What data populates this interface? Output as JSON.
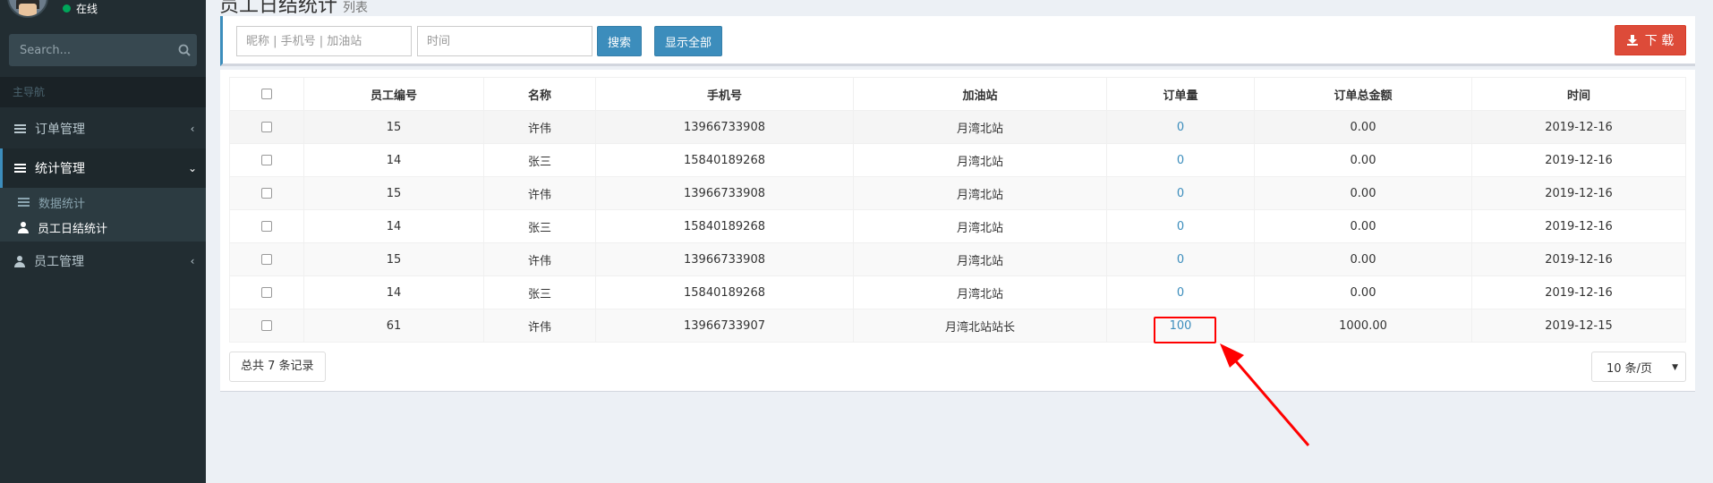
{
  "user": {
    "status": "在线"
  },
  "search": {
    "placeholder": "Search..."
  },
  "nav": {
    "header": "主导航",
    "items": [
      {
        "label": "订单管理",
        "icon": "bars-icon",
        "chevron": "‹"
      },
      {
        "label": "统计管理",
        "icon": "bars-icon",
        "chevron": "⌄"
      },
      {
        "label": "员工管理",
        "icon": "user-icon",
        "chevron": "‹"
      }
    ],
    "sub_items": [
      {
        "label": "数据统计",
        "icon": "bars-icon"
      },
      {
        "label": "员工日结统计",
        "icon": "user-icon"
      }
    ]
  },
  "page": {
    "title": "员工日结统计",
    "subtitle": "列表"
  },
  "toolbar": {
    "keyword_placeholder": "昵称 | 手机号 | 加油站",
    "time_placeholder": "时间",
    "search_label": "搜索",
    "show_all_label": "显示全部",
    "download_label": "下 载"
  },
  "table": {
    "headers": [
      "员工编号",
      "名称",
      "手机号",
      "加油站",
      "订单量",
      "订单总金额",
      "时间"
    ],
    "rows": [
      [
        "15",
        "许伟",
        "13966733908",
        "月湾北站",
        "0",
        "0.00",
        "2019-12-16"
      ],
      [
        "14",
        "张三",
        "15840189268",
        "月湾北站",
        "0",
        "0.00",
        "2019-12-16"
      ],
      [
        "15",
        "许伟",
        "13966733908",
        "月湾北站",
        "0",
        "0.00",
        "2019-12-16"
      ],
      [
        "14",
        "张三",
        "15840189268",
        "月湾北站",
        "0",
        "0.00",
        "2019-12-16"
      ],
      [
        "15",
        "许伟",
        "13966733908",
        "月湾北站",
        "0",
        "0.00",
        "2019-12-16"
      ],
      [
        "14",
        "张三",
        "15840189268",
        "月湾北站",
        "0",
        "0.00",
        "2019-12-16"
      ],
      [
        "61",
        "许伟",
        "13966733907",
        "月湾北站站长",
        "100",
        "1000.00",
        "2019-12-15"
      ]
    ]
  },
  "footer": {
    "total": "总共 7 条记录",
    "page_size": "10 条/页"
  },
  "colors": {
    "sidebar": "#222d32",
    "accent": "#3c8dbc",
    "danger": "#dd4b39",
    "annotation": "#ff0000"
  }
}
